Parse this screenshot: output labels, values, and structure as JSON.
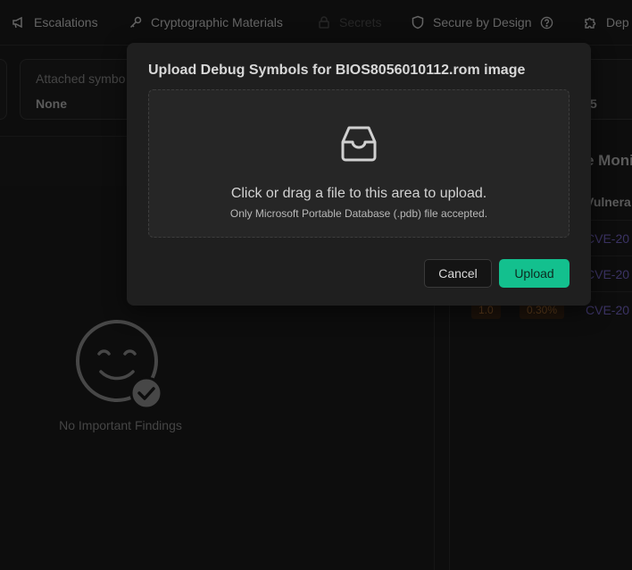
{
  "nav": {
    "items": [
      {
        "label": "Escalations",
        "icon": "megaphone-icon"
      },
      {
        "label": "Cryptographic Materials",
        "icon": "key-icon"
      },
      {
        "label": "Secrets",
        "icon": "lock-icon",
        "disabled": true
      },
      {
        "label": "Secure by Design",
        "icon": "shield-icon",
        "help": true
      },
      {
        "label": "Dep",
        "icon": "puzzle-icon"
      }
    ]
  },
  "background": {
    "attached_symbols_label": "Attached symbo",
    "attached_symbols_value": "None",
    "right_card_value": "5",
    "right_panel_title": "e Moni",
    "right_panel_header": "Vulnera",
    "rows": [
      {
        "cve": "CVE-20"
      },
      {
        "cve": "CVE-20"
      },
      {
        "score": "1.0",
        "percent": "0.30%",
        "cve": "CVE-20"
      }
    ],
    "empty_state_text": "No Important Findings"
  },
  "modal": {
    "title": "Upload Debug Symbols for BIOS8056010112.rom image",
    "dropzone_primary": "Click or drag a file to this area to upload.",
    "dropzone_secondary": "Only Microsoft Portable Database (.pdb) file accepted.",
    "cancel_label": "Cancel",
    "upload_label": "Upload"
  },
  "colors": {
    "accent": "#13c08e",
    "badge_bg": "#2b1c10",
    "link": "#5b4f9a"
  }
}
